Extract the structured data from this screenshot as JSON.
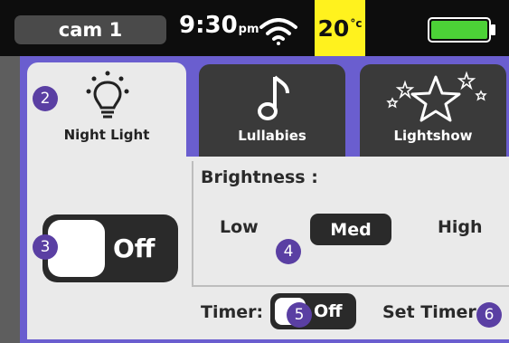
{
  "status_bar": {
    "camera_label": "cam 1",
    "time": "9:30",
    "time_suffix": "pm",
    "temperature": "20",
    "temperature_unit": "°c",
    "wifi_icon": "wifi-icon",
    "battery_icon": "battery-icon"
  },
  "tabs": [
    {
      "label": "Night Light",
      "icon": "lightbulb-icon",
      "selected": true
    },
    {
      "label": "Lullabies",
      "icon": "music-note-icon",
      "selected": false
    },
    {
      "label": "Lightshow",
      "icon": "stars-icon",
      "selected": false
    }
  ],
  "night_light": {
    "toggle_state": "Off"
  },
  "brightness": {
    "title": "Brightness :",
    "options": [
      "Low",
      "Med",
      "High"
    ],
    "selected": "Med"
  },
  "timer": {
    "label": "Timer:",
    "toggle_state": "Off",
    "set_timer_label": "Set Timer"
  },
  "markers": [
    "2",
    "3",
    "4",
    "5",
    "6"
  ],
  "colors": {
    "panel_background": "#6a5ecf",
    "marker": "#5a3fa3",
    "temperature_highlight": "#fff21e",
    "battery": "#4cd137",
    "status_bar": "#0d0d0d"
  }
}
